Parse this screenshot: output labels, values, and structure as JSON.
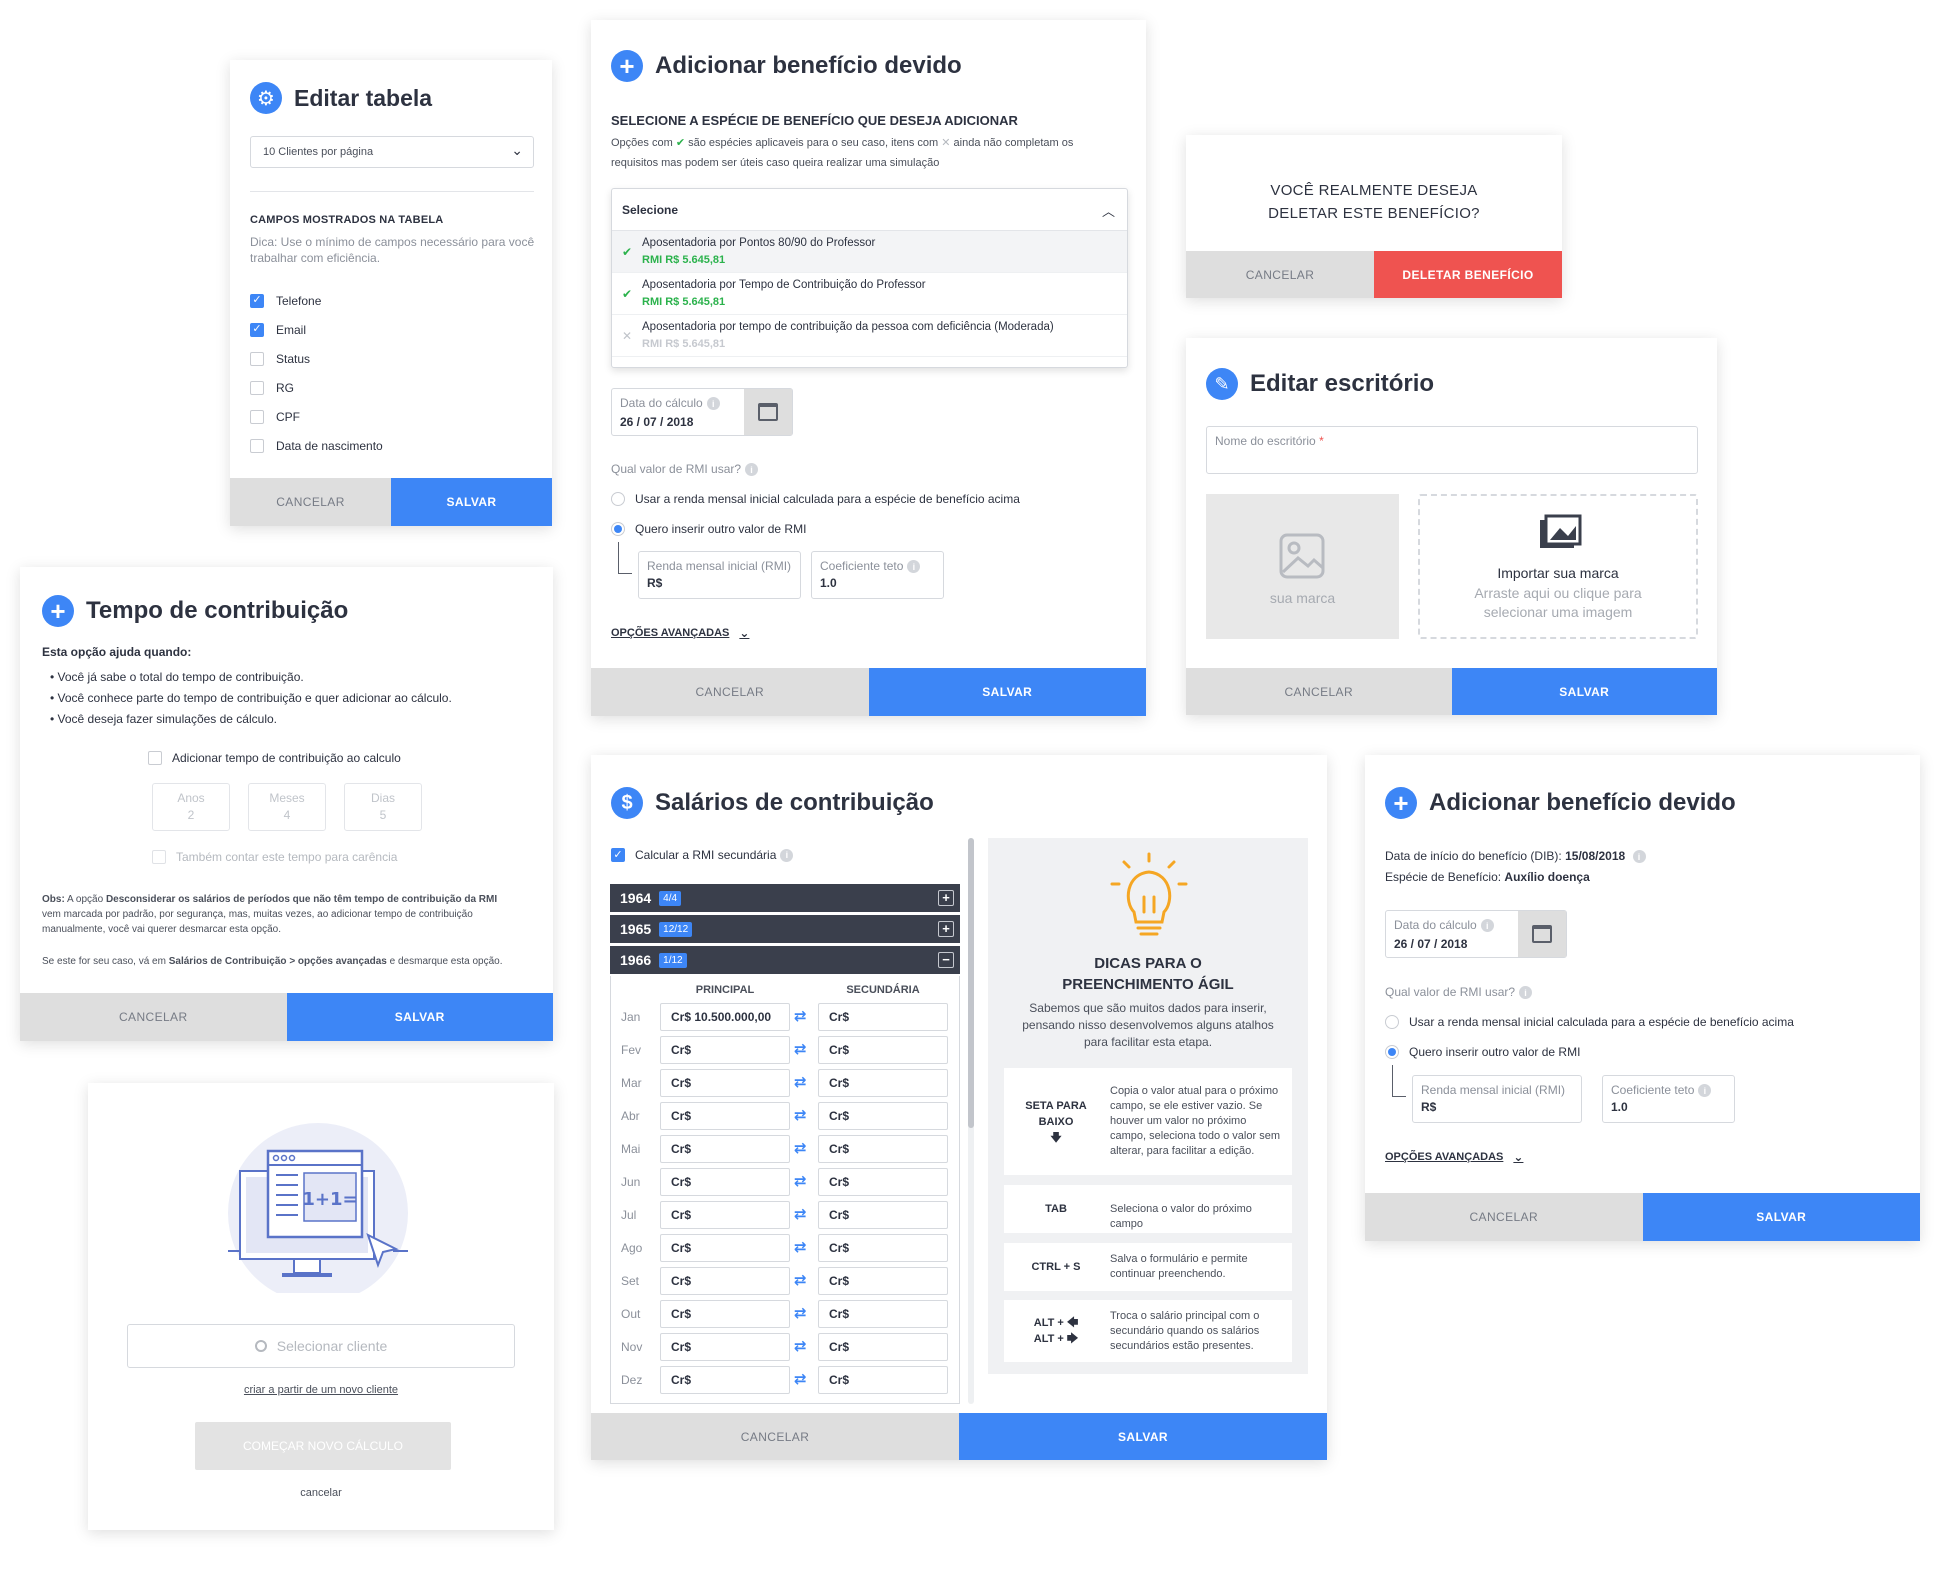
{
  "editar_tabela": {
    "title": "Editar tabela",
    "select_value": "10 Clientes por página",
    "section_title": "CAMPOS MOSTRADOS NA TABELA",
    "hint": "Dica: Use o mínimo de campos necessário para você trabalhar com eficiência.",
    "fields": [
      {
        "label": "Telefone",
        "checked": true
      },
      {
        "label": "Email",
        "checked": true
      },
      {
        "label": "Status",
        "checked": false
      },
      {
        "label": "RG",
        "checked": false
      },
      {
        "label": "CPF",
        "checked": false
      },
      {
        "label": "Data de nascimento",
        "checked": false
      }
    ],
    "cancel": "CANCELAR",
    "save": "SALVAR"
  },
  "tempo": {
    "title": "Tempo de contribuição",
    "intro": "Esta opção ajuda quando:",
    "bullets": [
      "• Você já sabe o total do tempo de contribuição.",
      "• Você conhece parte do tempo de contribuição e quer adicionar ao cálculo.",
      "• Você deseja fazer simulações de cálculo."
    ],
    "checkbox_label": "Adicionar tempo de contribuição ao calculo",
    "anos_label": "Anos",
    "anos_value": "2",
    "meses_label": "Meses",
    "meses_value": "4",
    "dias_label": "Dias",
    "dias_value": "5",
    "carencia_label": "Também contar este tempo para carência",
    "obs_prefix": "Obs:",
    "obs_text1": " A opção ",
    "obs_bold": "Desconsiderar os salários de períodos que não têm tempo de contribuição da RMI",
    "obs_text2": " vem marcada por padrão, por segurança, mas, muitas vezes, ao adicionar tempo de contribuição manualmente, você vai querer desmarcar esta opção.",
    "note_text1": "Se este for seu caso, vá em ",
    "note_bold1": "Salários de Contribuição > opções avançadas",
    "note_text2": " e desmarque esta opção.",
    "cancel": "CANCELAR",
    "save": "SALVAR"
  },
  "novo_calculo": {
    "search_placeholder": "Selecionar cliente",
    "link": "criar a partir de um novo cliente",
    "start_button": "COMEÇAR NOVO CÁLCULO",
    "cancel_link": "cancelar",
    "illustration_text": "1+1="
  },
  "adicionar1": {
    "title": "Adicionar benefício devido",
    "subtitle": "SELECIONE A ESPÉCIE DE BENEFÍCIO QUE DESEJA ADICIONAR",
    "desc1": "Opções com",
    "desc2": "são espécies aplicaveis para o seu caso, itens com",
    "desc3": "ainda não completam os requisitos mas podem ser úteis caso queira realizar uma simulação",
    "select_label": "Selecione",
    "options": [
      {
        "name": "Aposentadoria por Pontos 80/90 do Professor",
        "rmi": "RMI R$ 5.645,81",
        "status": "ok"
      },
      {
        "name": "Aposentadoria por Tempo de Contribuição do Professor",
        "rmi": "RMI R$ 5.645,81",
        "status": "ok"
      },
      {
        "name": "Aposentadoria por tempo de contribuição da pessoa com deficiência (Moderada)",
        "rmi": "RMI R$ 5.645,81",
        "status": "no"
      }
    ],
    "date_label": "Data do cálculo",
    "date_value": "26 / 07 / 2018",
    "rmi_question": "Qual valor de RMI usar?",
    "radio1": "Usar a renda mensal inicial calculada para a espécie de benefício acima",
    "radio2": "Quero inserir outro valor de RMI",
    "rmi_label": "Renda mensal inicial (RMI)",
    "rmi_value": "R$",
    "coef_label": "Coeficiente teto",
    "coef_value": "1.0",
    "advanced": "OPÇÕES AVANÇADAS",
    "cancel": "CANCELAR",
    "save": "SALVAR"
  },
  "deletar": {
    "question_line1": "VOCÊ REALMENTE DESEJA",
    "question_line2": "DELETAR ESTE BENEFÍCIO?",
    "cancel": "CANCELAR",
    "delete": "DELETAR BENEFÍCIO"
  },
  "escritorio": {
    "title": "Editar escritório",
    "name_label": "Nome do escritório",
    "required_mark": "*",
    "logo_placeholder": "sua marca",
    "import_title": "Importar sua marca",
    "import_desc": "Arraste aqui ou clique para selecionar uma imagem",
    "cancel": "CANCELAR",
    "save": "SALVAR"
  },
  "salarios": {
    "title": "Salários de contribuição",
    "checkbox_label": "Calcular a RMI secundária",
    "years": [
      {
        "year": "1964",
        "badge": "4/4",
        "toggle": "+"
      },
      {
        "year": "1965",
        "badge": "12/12",
        "toggle": "+"
      },
      {
        "year": "1966",
        "badge": "1/12",
        "toggle": "−"
      }
    ],
    "col_principal": "PRINCIPAL",
    "col_secundaria": "SECUNDÁRIA",
    "months": [
      {
        "m": "Jan",
        "p": "Cr$ 10.500.000,00",
        "s": "Cr$"
      },
      {
        "m": "Fev",
        "p": "Cr$",
        "s": "Cr$"
      },
      {
        "m": "Mar",
        "p": "Cr$",
        "s": "Cr$"
      },
      {
        "m": "Abr",
        "p": "Cr$",
        "s": "Cr$"
      },
      {
        "m": "Mai",
        "p": "Cr$",
        "s": "Cr$"
      },
      {
        "m": "Jun",
        "p": "Cr$",
        "s": "Cr$"
      },
      {
        "m": "Jul",
        "p": "Cr$",
        "s": "Cr$"
      },
      {
        "m": "Ago",
        "p": "Cr$",
        "s": "Cr$"
      },
      {
        "m": "Set",
        "p": "Cr$",
        "s": "Cr$"
      },
      {
        "m": "Out",
        "p": "Cr$",
        "s": "Cr$"
      },
      {
        "m": "Nov",
        "p": "Cr$",
        "s": "Cr$"
      },
      {
        "m": "Dez",
        "p": "Cr$",
        "s": "Cr$"
      }
    ],
    "tips_title_line1": "DICAS PARA O",
    "tips_title_line2": "PREENCHIMENTO ÁGIL",
    "tips_desc": "Sabemos que são muitos dados para inserir, pensando nisso desenvolvemos alguns atalhos para facilitar esta etapa.",
    "tips": [
      {
        "key1": "SETA PARA",
        "key2": "BAIXO",
        "key3": "🡇",
        "text": "Copia o valor atual para o próximo campo, se ele estiver vazio. Se houver um valor no próximo campo, seleciona todo o valor sem alterar, para facilitar a edição."
      },
      {
        "key1": "TAB",
        "text": "Seleciona o valor do próximo campo"
      },
      {
        "key1": "CTRL + S",
        "text": "Salva o formulário e permite continuar preenchendo."
      },
      {
        "key1": "ALT + 🡄",
        "key2": "ALT + 🡆",
        "text": "Troca o salário principal com o secundário quando os salários secundários estão presentes."
      }
    ],
    "cancel": "CANCELAR",
    "save": "SALVAR"
  },
  "adicionar2": {
    "title": "Adicionar benefício devido",
    "dib_label": "Data de início do benefício (DIB):",
    "dib_value": "15/08/2018",
    "especie_label": "Espécie de Benefício:",
    "especie_value": "Auxílio doença",
    "date_label": "Data do cálculo",
    "date_value": "26 / 07 / 2018",
    "rmi_question": "Qual valor de RMI usar?",
    "radio1": "Usar a renda mensal inicial calculada para a espécie de benefício acima",
    "radio2": "Quero inserir outro valor de RMI",
    "rmi_label": "Renda mensal inicial (RMI)",
    "rmi_value": "R$",
    "coef_label": "Coeficiente teto",
    "coef_value": "1.0",
    "advanced": "OPÇÕES AVANÇADAS",
    "cancel": "CANCELAR",
    "save": "SALVAR"
  },
  "colors": {
    "primary": "#3d86f6",
    "danger": "#ef5350",
    "dark": "#3a3f4c",
    "success": "#2bb24c",
    "warning": "#f5a623"
  }
}
